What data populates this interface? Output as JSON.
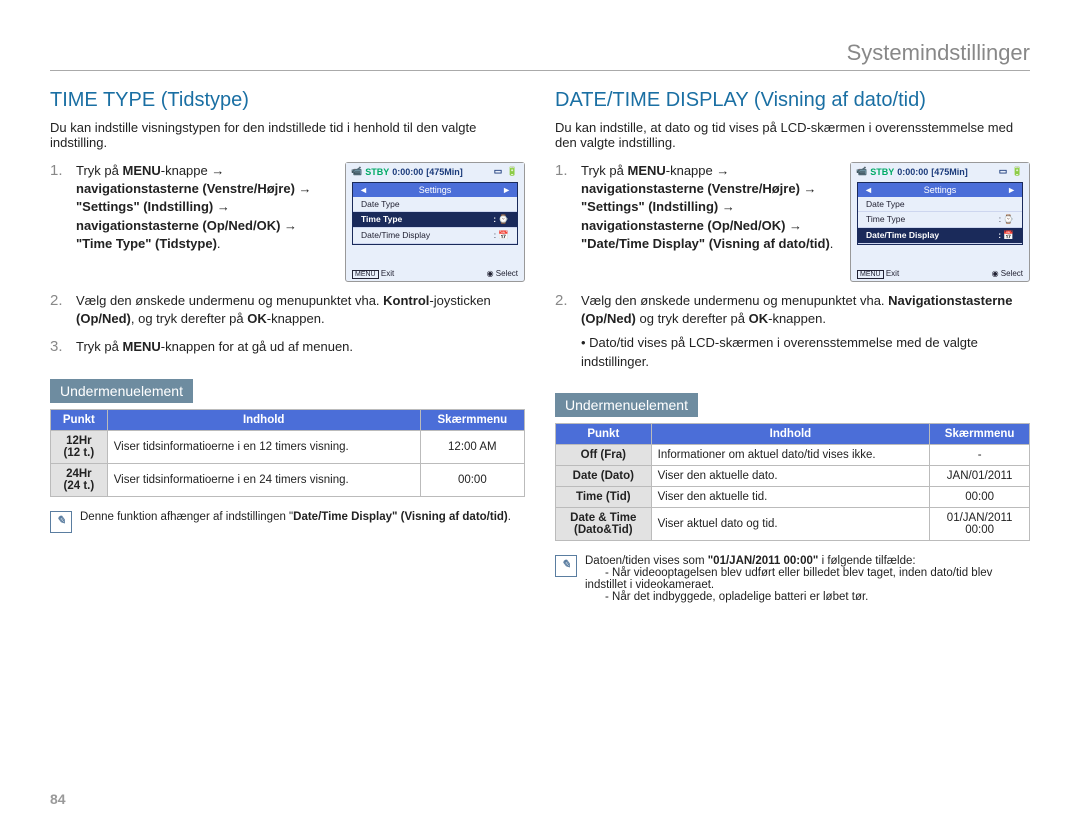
{
  "page_header": "Systemindstillinger",
  "page_number": "84",
  "left": {
    "title": "TIME TYPE (Tidstype)",
    "intro": "Du kan indstille visningstypen for den indstillede tid i henhold til den valgte indstilling.",
    "step1_pre": "Tryk på ",
    "step1_b1": "MENU",
    "step1_mid1": "-knappe → ",
    "step1_b2": "navigationstasterne (Venstre/Højre)",
    "step1_mid2": " → ",
    "step1_b3": "\"Settings\" (Indstilling)",
    "step1_mid3": " → ",
    "step1_b4": "navigationstasterne (Op/Ned/OK)",
    "step1_mid4": " → ",
    "step1_b5": "\"Time Type\" (Tidstype)",
    "step1_end": ".",
    "step2a": "Vælg den ønskede undermenu og menupunktet vha. ",
    "step2b": "Kontrol",
    "step2c": "-joysticken ",
    "step2d": "(Op/Ned)",
    "step2e": ", og tryk derefter på ",
    "step2f": "OK",
    "step2g": "-knappen.",
    "step3a": "Tryk på ",
    "step3b": "MENU",
    "step3c": "-knappen for at gå ud af menuen.",
    "subhead": "Undermenuelement",
    "table": {
      "headers": [
        "Punkt",
        "Indhold",
        "Skærmmenu"
      ],
      "rows": [
        {
          "p": "12Hr\n(12 t.)",
          "i": "Viser tidsinformatioerne i en 12 timers visning.",
          "s": "12:00 AM"
        },
        {
          "p": "24Hr\n(24 t.)",
          "i": "Viser tidsinformatioerne i en 24 timers visning.",
          "s": "00:00"
        }
      ]
    },
    "note_a": "Denne funktion afhænger af indstillingen \"",
    "note_b": "Date/Time Display\" (Visning af dato/tid)",
    "note_c": ".",
    "lcd": {
      "stby": "STBY",
      "time": "0:00:00",
      "remain": "[475Min]",
      "menu_header": "Settings",
      "items": [
        "Date Type",
        "Time Type",
        "Date/Time Display"
      ],
      "selected": "Time Type",
      "exit": "MENU Exit",
      "select": "Select"
    }
  },
  "right": {
    "title": "DATE/TIME DISPLAY (Visning af dato/tid)",
    "intro": "Du kan indstille, at dato og tid vises på LCD-skærmen i overensstemmelse med den valgte indstilling.",
    "step1_pre": "Tryk på ",
    "step1_b1": "MENU",
    "step1_mid1": "-knappe → ",
    "step1_b2": "navigationstasterne (Venstre/Højre)",
    "step1_mid2": " → ",
    "step1_b3": "\"Settings\" (Indstilling)",
    "step1_mid3": " → ",
    "step1_b4": "navigationstasterne (Op/Ned/OK)",
    "step1_mid4": " → ",
    "step1_b5": "\"Date/Time Display\" (Visning af dato/tid)",
    "step1_end": ".",
    "step2a": "Vælg den ønskede undermenu og menupunktet vha. ",
    "step2b": "Navigationstasterne (Op/Ned)",
    "step2c": " og tryk derefter på ",
    "step2d": "OK",
    "step2e": "-knappen.",
    "step2_bullet": "Dato/tid vises på LCD-skærmen i overensstemmelse med de valgte indstillinger.",
    "subhead": "Undermenuelement",
    "table": {
      "headers": [
        "Punkt",
        "Indhold",
        "Skærmmenu"
      ],
      "rows": [
        {
          "p": "Off (Fra)",
          "i": "Informationer om aktuel dato/tid vises ikke.",
          "s": "-"
        },
        {
          "p": "Date (Dato)",
          "i": "Viser den aktuelle dato.",
          "s": "JAN/01/2011"
        },
        {
          "p": "Time (Tid)",
          "i": "Viser den aktuelle tid.",
          "s": "00:00"
        },
        {
          "p": "Date & Time\n(Dato&Tid)",
          "i": "Viser aktuel dato og tid.",
          "s": "01/JAN/2011\n00:00"
        }
      ]
    },
    "note_a": "Datoen/tiden vises som ",
    "note_b": "\"01/JAN/2011 00:00\"",
    "note_c": " i følgende tilfælde:",
    "note_li1": "Når videooptagelsen blev udført eller billedet blev taget, inden dato/tid blev indstillet i videokameraet.",
    "note_li2": "Når det indbyggede, opladelige batteri er løbet tør.",
    "lcd": {
      "stby": "STBY",
      "time": "0:00:00",
      "remain": "[475Min]",
      "menu_header": "Settings",
      "items": [
        "Date Type",
        "Time Type",
        "Date/Time Display"
      ],
      "selected": "Date/Time Display",
      "exit": "MENU Exit",
      "select": "Select"
    }
  }
}
